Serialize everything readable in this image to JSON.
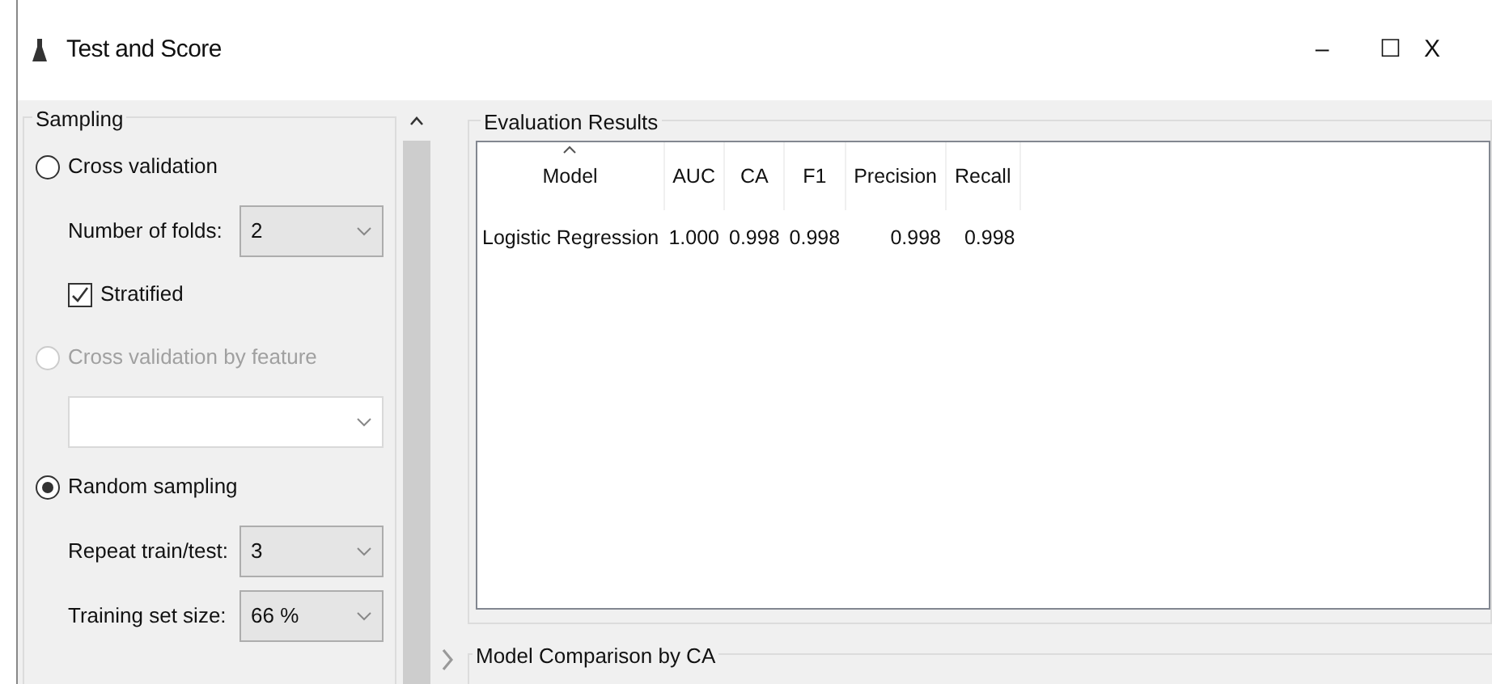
{
  "window": {
    "title": "Test and Score",
    "controls": [
      "–",
      "☐",
      "X"
    ]
  },
  "sampling": {
    "title": "Sampling",
    "items": [
      {
        "kind": "radio",
        "label": "Cross validation",
        "selected": false,
        "disabled": false
      },
      {
        "kind": "dropdown",
        "label": "Number of folds:",
        "value": "2"
      },
      {
        "kind": "checkbox",
        "label": "Stratified",
        "checked": true
      },
      {
        "kind": "radio",
        "label": "Cross validation by feature",
        "selected": false,
        "disabled": true
      },
      {
        "kind": "dropdown"
      },
      {
        "kind": "radio",
        "label": "Random sampling",
        "selected": true,
        "disabled": false
      },
      {
        "kind": "dropdown",
        "label": "Repeat train/test:",
        "value": "3"
      },
      {
        "kind": "dropdown",
        "label": "Training set size:",
        "value": "66 %"
      }
    ]
  },
  "evaluation": {
    "title": "Evaluation Results",
    "columns": [
      {
        "label": "Model",
        "sorted": true
      },
      {
        "label": "AUC",
        "sorted": false
      },
      {
        "label": "CA",
        "sorted": false
      },
      {
        "label": "F1",
        "sorted": false
      },
      {
        "label": "Precision",
        "sorted": false
      },
      {
        "label": "Recall",
        "sorted": false
      }
    ],
    "rows": [
      [
        "Logistic Regression",
        "1.000",
        "0.998",
        "0.998",
        "0.998",
        "0.998"
      ]
    ]
  },
  "comparison": {
    "title": "Model Comparison by CA"
  }
}
